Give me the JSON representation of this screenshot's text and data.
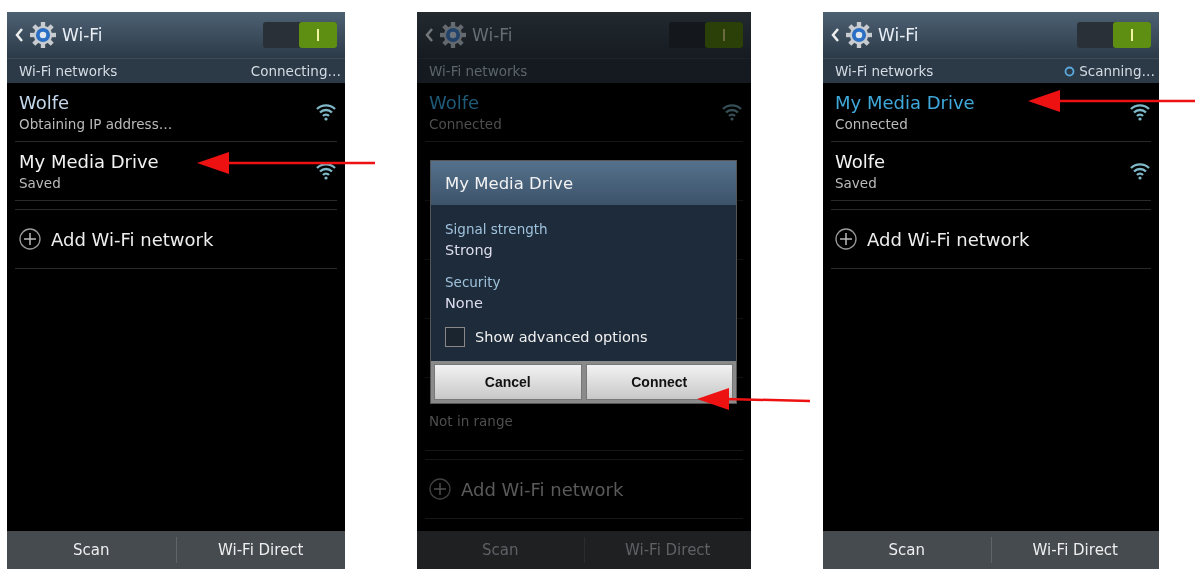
{
  "panels": [
    {
      "dimmed": false,
      "header": {
        "title": "Wi-Fi",
        "switch_on": true
      },
      "section": {
        "label": "Wi-Fi networks",
        "status": "Connecting…"
      },
      "networks": [
        {
          "name": "Wolfe",
          "status": "Obtaining IP address…",
          "color": "#c4d8ec"
        },
        {
          "name": "My Media Drive",
          "status": "Saved",
          "color": "#f2f2f2"
        }
      ],
      "add_label": "Add Wi-Fi network",
      "bottom_buttons": [
        "Scan",
        "Wi-Fi Direct"
      ]
    },
    {
      "dimmed": true,
      "header": {
        "title": "Wi-Fi",
        "switch_on": true
      },
      "section": {
        "label": "Wi-Fi networks"
      },
      "networks": [
        {
          "name": "Wolfe",
          "status": "Connected",
          "color": "#1e5a78"
        },
        {
          "status": "Not in range"
        }
      ],
      "dialog": {
        "title": "My Media Drive",
        "fields": [
          {
            "label": "Signal strength",
            "value": "Strong"
          },
          {
            "label": "Security",
            "value": "None"
          }
        ],
        "checkbox": {
          "label": "Show advanced options",
          "checked": false
        },
        "buttons": [
          "Cancel",
          "Connect"
        ]
      },
      "add_label": "Add Wi-Fi network",
      "bottom_buttons": [
        "Scan",
        "Wi-Fi Direct"
      ]
    },
    {
      "dimmed": false,
      "header": {
        "title": "Wi-Fi",
        "switch_on": true
      },
      "section": {
        "label": "Wi-Fi networks",
        "status": "Scanning…",
        "spinner": true
      },
      "networks": [
        {
          "name": "My Media Drive",
          "status": "Connected",
          "color": "#3fa9dc"
        },
        {
          "name": "Wolfe",
          "status": "Saved",
          "color": "#f2f2f2"
        }
      ],
      "add_label": "Add Wi-Fi network",
      "bottom_buttons": [
        "Scan",
        "Wi-Fi Direct"
      ]
    }
  ]
}
